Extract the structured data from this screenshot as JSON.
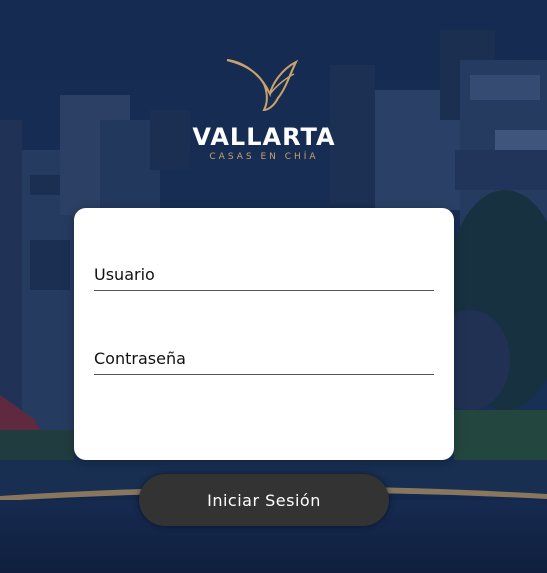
{
  "brand": {
    "name": "VALLARTA",
    "tagline": "CASAS EN CHÍA",
    "logo_icon": "bird-icon",
    "accent_color": "#c9a36a"
  },
  "form": {
    "username_placeholder": "Usuario",
    "password_placeholder": "Contraseña",
    "username_value": "",
    "password_value": ""
  },
  "actions": {
    "login_label": "Iniciar Sesión",
    "button_color": "#333333"
  },
  "background": {
    "base_color": "#14264a",
    "accent_line_color": "#c9a36a"
  }
}
